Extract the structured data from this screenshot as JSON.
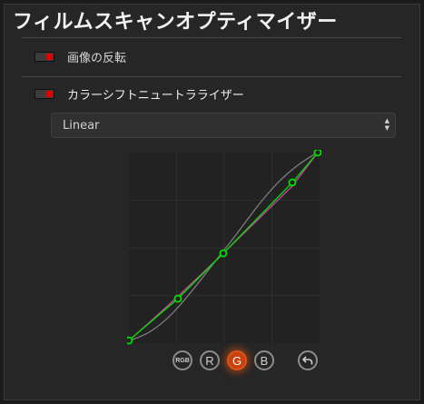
{
  "window": {
    "title": "フィルムスキャンオプティマイザー"
  },
  "rows": [
    {
      "label": "画像の反転",
      "enabled": false
    },
    {
      "label": "カラーシフトニュートラライザー",
      "enabled": true
    }
  ],
  "mode_select": {
    "value": "Linear"
  },
  "curve_buttons": [
    "RGB",
    "R",
    "G",
    "B"
  ],
  "active_channel": "G",
  "colors": {
    "accent": "#c9410d",
    "green_curve": "#00e000",
    "magenta_curve": "#d03fa8",
    "grey_curve": "#7a7a7a",
    "toggle_on": "#e00000"
  },
  "icons": {
    "reset": "undo-arrow-icon"
  }
}
